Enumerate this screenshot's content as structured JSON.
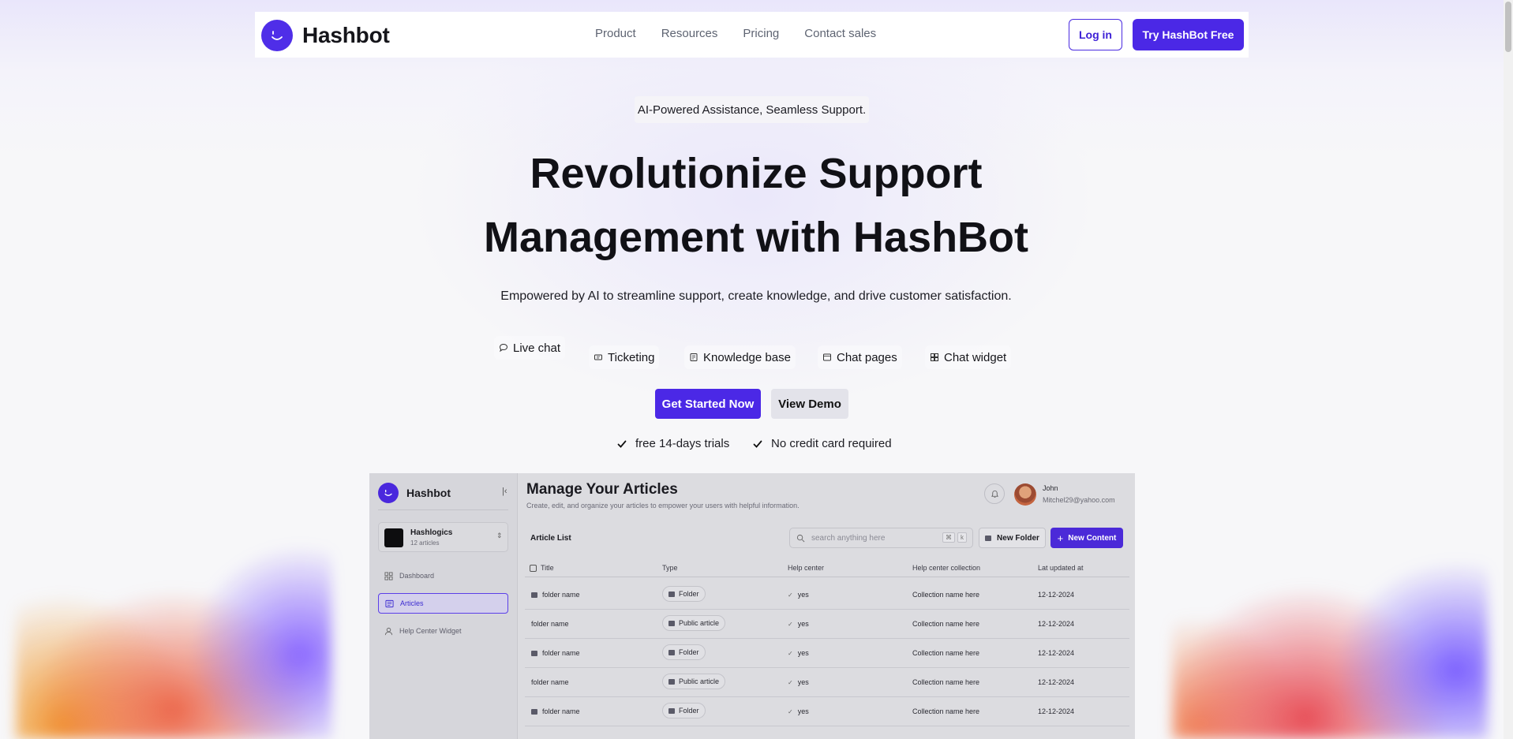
{
  "header": {
    "brand": "Hashbot",
    "nav": [
      "Product",
      "Resources",
      "Pricing",
      "Contact sales"
    ],
    "login_label": "Log in",
    "try_label": "Try HashBot Free"
  },
  "hero": {
    "tagline": "AI-Powered Assistance, Seamless Support.",
    "title_line1": "Revolutionize Support",
    "title_line2": "Management with HashBot",
    "subtitle": "Empowered by AI to streamline support, create knowledge, and drive customer satisfaction.",
    "features": [
      "Live chat",
      "Ticketing",
      "Knowledge base",
      "Chat pages",
      "Chat widget"
    ],
    "primary_cta": "Get Started Now",
    "secondary_cta": "View Demo",
    "checks": [
      "free 14-days trials",
      "No credit card required"
    ]
  },
  "preview": {
    "brand": "Hashbot",
    "workspace": {
      "name": "Hashlogics",
      "count": "12 articles"
    },
    "sidebar": [
      "Dashboard",
      "Articles",
      "Help Center Widget"
    ],
    "title": "Manage Your Articles",
    "description": "Create, edit, and organize your articles to empower your users with helpful information.",
    "user": {
      "name": "John",
      "email": "Mitchel29@yahoo.com"
    },
    "list_title": "Article List",
    "search_placeholder": "search anything here",
    "search_kbd": [
      "⌘",
      "k"
    ],
    "new_folder": "New Folder",
    "new_content": "New Content",
    "columns": [
      "Title",
      "Type",
      "Help center",
      "Help center collection",
      "Lat updated at"
    ],
    "rows": [
      {
        "title": "folder name",
        "folder": true,
        "type": "Folder",
        "help": "yes",
        "collection": "Collection name here",
        "date": "12-12-2024"
      },
      {
        "title": "folder name",
        "folder": false,
        "type": "Public article",
        "help": "yes",
        "collection": "Collection name here",
        "date": "12-12-2024"
      },
      {
        "title": "folder name",
        "folder": true,
        "type": "Folder",
        "help": "yes",
        "collection": "Collection name here",
        "date": "12-12-2024"
      },
      {
        "title": "folder name",
        "folder": false,
        "type": "Public article",
        "help": "yes",
        "collection": "Collection name here",
        "date": "12-12-2024"
      },
      {
        "title": "folder name",
        "folder": true,
        "type": "Folder",
        "help": "yes",
        "collection": "Collection name here",
        "date": "12-12-2024"
      }
    ]
  },
  "colors": {
    "accent": "#4b28e6",
    "text": "#111116",
    "muted": "#5e6472"
  }
}
